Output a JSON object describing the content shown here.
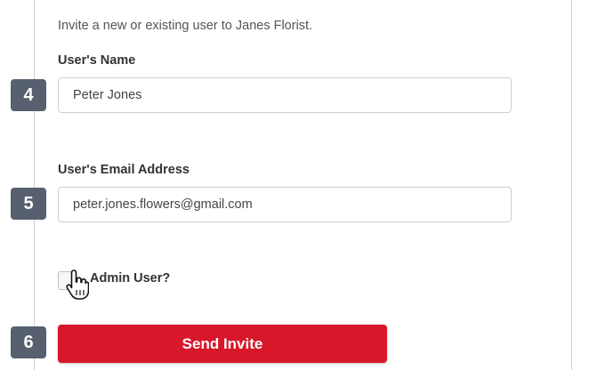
{
  "form": {
    "intro_text": "Invite a new or existing user to Janes Florist.",
    "name_label": "User's Name",
    "name_value": "Peter Jones",
    "email_label": "User's Email Address",
    "email_value": "peter.jones.flowers@gmail.com",
    "admin_label": "Admin User?",
    "admin_checked": false,
    "send_label": "Send Invite"
  },
  "steps": {
    "name_step": "4",
    "email_step": "5",
    "send_step": "6"
  },
  "colors": {
    "accent": "#d8172a",
    "step_badge": "#56606e"
  },
  "icons": {
    "cursor": "hand-pointer-icon"
  }
}
